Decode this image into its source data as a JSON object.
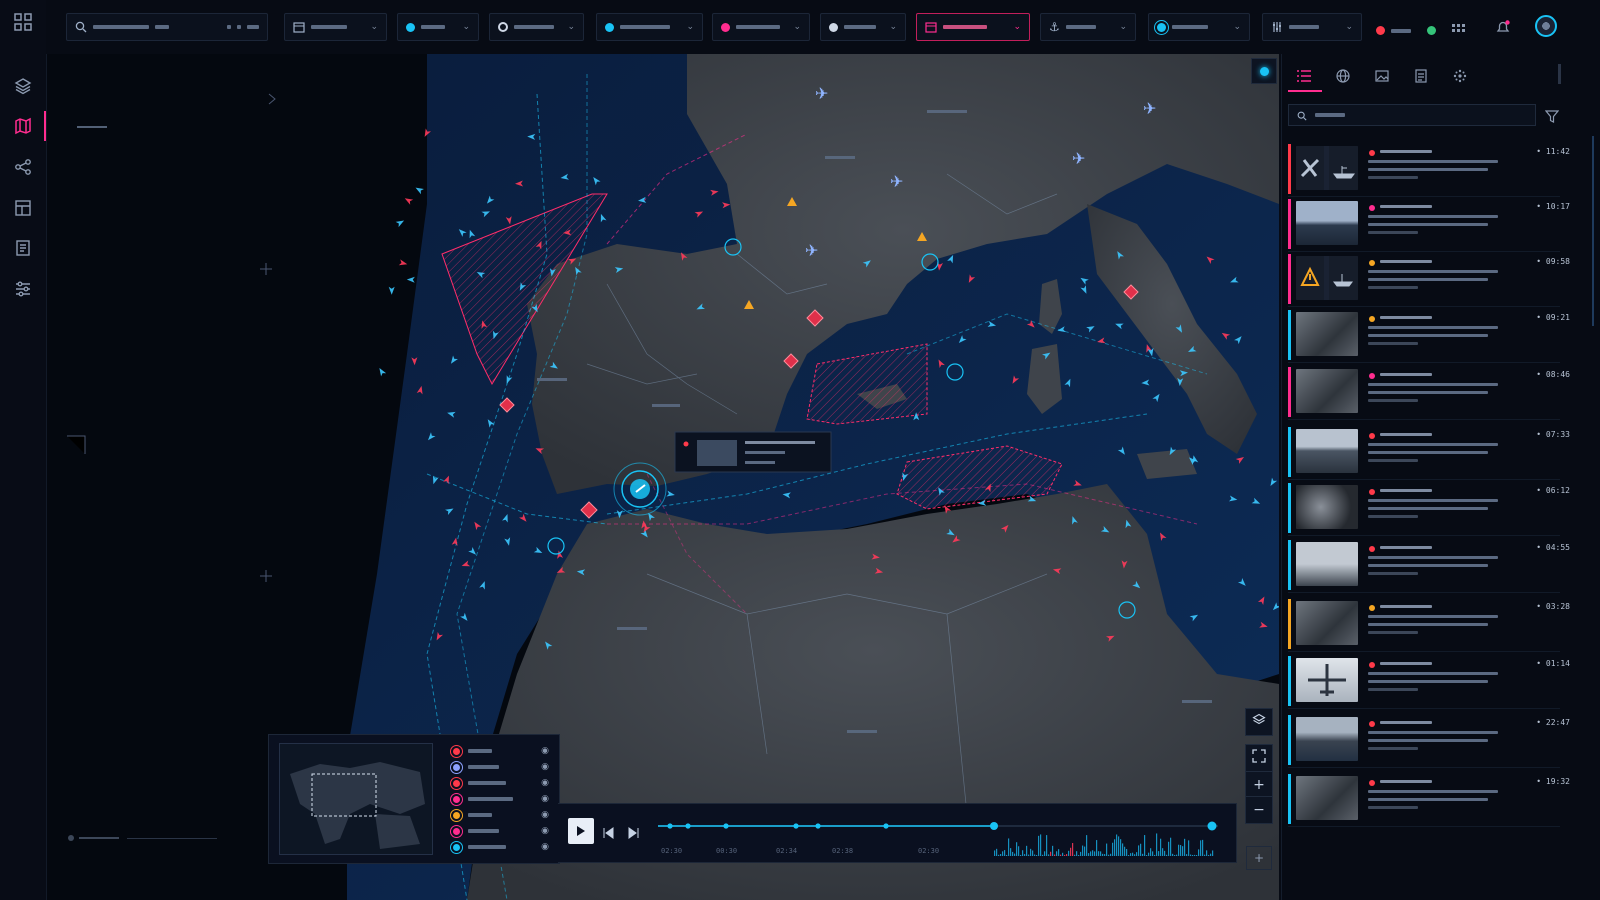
{
  "colors": {
    "bg": "#070b14",
    "accent_magenta": "#ff2d8f",
    "accent_cyan": "#19c3f5",
    "alert_red": "#ff3a4a",
    "warn_amber": "#f5a623",
    "ok_green": "#35c47a",
    "sea": "#0b2347",
    "land": "#3d4248"
  },
  "topbar": {
    "app_grid_icon": "grid-icon",
    "filters": [
      {
        "icon": "search-icon"
      },
      {
        "icon": "calendar-icon"
      },
      {
        "icon": "dot-cyan-icon",
        "color": "#19c3f5"
      },
      {
        "icon": "dot-white-icon",
        "color": "#cfd8e6"
      },
      {
        "icon": "dot-cyan-icon",
        "color": "#19c3f5"
      },
      {
        "icon": "dot-magenta-icon",
        "color": "#ff2d8f"
      },
      {
        "icon": "dot-white-icon",
        "color": "#cfd8e6"
      },
      {
        "icon": "calendar-icon",
        "selected": true
      },
      {
        "icon": "anchor-icon"
      },
      {
        "icon": "dot-cyan-icon",
        "color": "#19c3f5"
      },
      {
        "icon": "sliders-icon"
      }
    ],
    "status_icons": [
      "status-red-icon",
      "status-green-icon",
      "grid-small-icon",
      "notification-icon",
      "user-avatar-icon"
    ]
  },
  "rail": {
    "items": [
      {
        "icon": "layers-icon"
      },
      {
        "icon": "map-icon",
        "active": true
      },
      {
        "icon": "network-icon"
      },
      {
        "icon": "dashboard-icon"
      },
      {
        "icon": "document-icon"
      },
      {
        "icon": "settings-sliders-icon"
      }
    ]
  },
  "panel": {
    "tabs": [
      "list-icon",
      "globe-icon",
      "image-icon",
      "report-icon",
      "sensor-icon"
    ],
    "active_tab": "list-icon",
    "feed": [
      {
        "time": "11:42",
        "bar": "#ff3a4a",
        "status": "#ff3a4a",
        "thumb": "aircraft-ship-icons"
      },
      {
        "time": "10:17",
        "bar": "#ff2d8f",
        "status": "#ff2d8f",
        "thumb": "warship-photo"
      },
      {
        "time": "09:58",
        "bar": "#ff2d8f",
        "status": "#f5a623",
        "thumb": "warning-ship-icons"
      },
      {
        "time": "09:21",
        "bar": "#19c3f5",
        "status": "#f5a623",
        "thumb": "aerial-photo"
      },
      {
        "time": "08:46",
        "bar": "#ff2d8f",
        "status": "#ff2d8f",
        "thumb": "aerial-photo"
      },
      {
        "time": "07:33",
        "bar": "#19c3f5",
        "status": "#ff3a4a",
        "thumb": "ship-photo"
      },
      {
        "time": "06:12",
        "bar": "#19c3f5",
        "status": "#ff3a4a",
        "thumb": "smoke-photo"
      },
      {
        "time": "04:55",
        "bar": "#19c3f5",
        "status": "#ff3a4a",
        "thumb": "port-photo"
      },
      {
        "time": "03:28",
        "bar": "#f5a623",
        "status": "#f5a623",
        "thumb": "aerial-photo"
      },
      {
        "time": "01:14",
        "bar": "#19c3f5",
        "status": "#ff3a4a",
        "thumb": "aircraft-photo"
      },
      {
        "time": "22:47",
        "bar": "#19c3f5",
        "status": "#ff3a4a",
        "thumb": "coast-photo"
      },
      {
        "time": "19:32",
        "bar": "#19c3f5",
        "status": "#ff3a4a",
        "thumb": "aerial-photo"
      }
    ]
  },
  "legend": [
    {
      "color": "#ff3a4a"
    },
    {
      "color": "#8da2ff"
    },
    {
      "color": "#ff3a4a"
    },
    {
      "color": "#ff2d8f"
    },
    {
      "color": "#f5a623"
    },
    {
      "color": "#ff2d8f"
    },
    {
      "color": "#19c3f5"
    }
  ],
  "timeline": {
    "times": [
      "02:30",
      "00:30",
      "02:34",
      "02:38",
      "02:30"
    ],
    "progress": 0.6
  },
  "map_controls": [
    "layers-icon",
    "fit-icon",
    "zoom-in-icon",
    "zoom-out-icon"
  ],
  "zoom_in_label": "+",
  "zoom_out_label": "−"
}
